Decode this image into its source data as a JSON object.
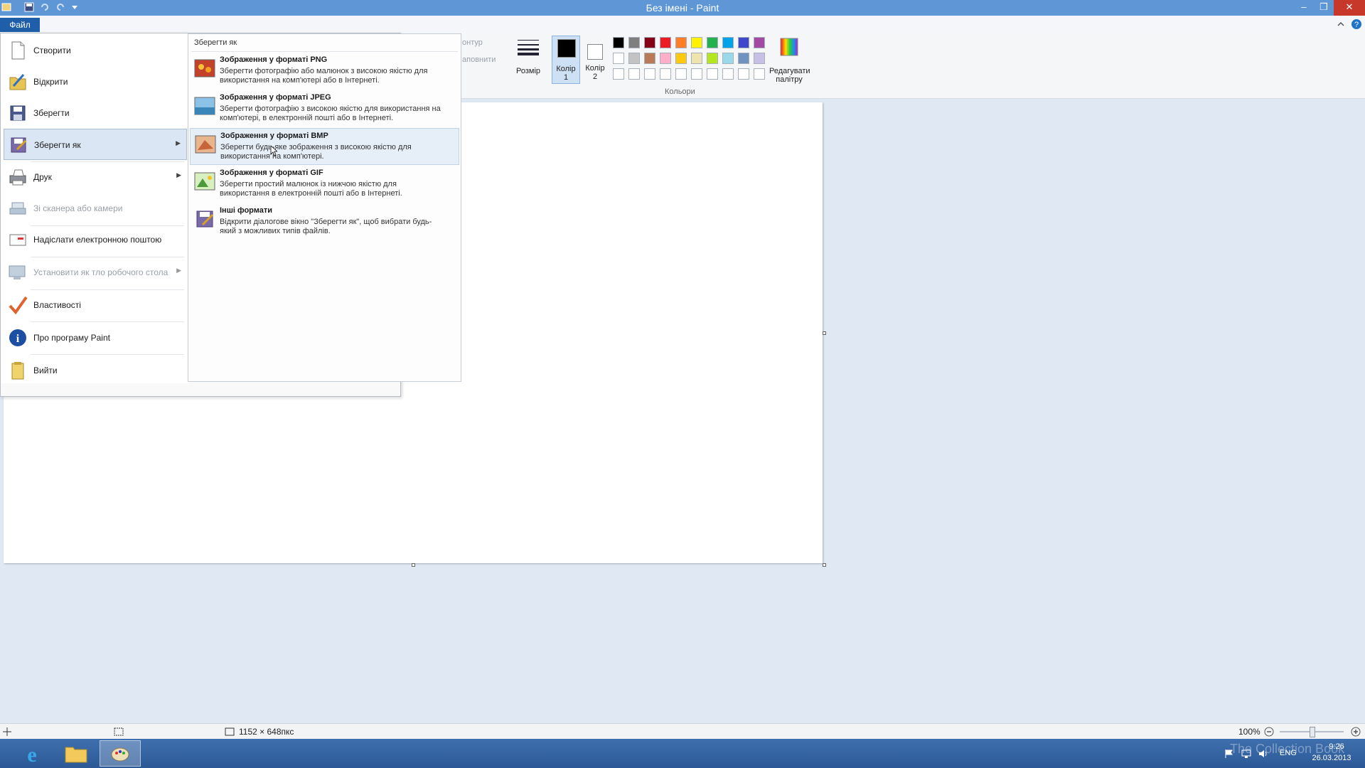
{
  "window": {
    "title": "Без імені - Paint",
    "controls": {
      "minimize": "–",
      "restore": "❐",
      "close": "✕"
    }
  },
  "ribbon": {
    "file_tab": "Файл",
    "shapes": {
      "outline": "онтур",
      "fill": "аповнити"
    },
    "size_label": "Розмір",
    "color1_label": "Колір",
    "color1_num": "1",
    "color2_label": "Колір",
    "color2_num": "2",
    "edit_colors_label": "Редагувати",
    "edit_colors_label2": "палітру",
    "colors_group_label": "Кольори",
    "palette_row1": [
      "#000000",
      "#7f7f7f",
      "#880015",
      "#ed1c24",
      "#ff7f27",
      "#fff200",
      "#22b14c",
      "#00a2e8",
      "#3f48cc",
      "#a349a4"
    ],
    "palette_row2": [
      "#ffffff",
      "#c3c3c3",
      "#b97a57",
      "#ffaec9",
      "#ffc90e",
      "#efe4b0",
      "#b5e61d",
      "#99d9ea",
      "#7092be",
      "#c8bfe7"
    ]
  },
  "file_menu": {
    "items": [
      {
        "label": "Створити",
        "icon": "new-file-icon"
      },
      {
        "label": "Відкрити",
        "icon": "open-folder-icon"
      },
      {
        "label": "Зберегти",
        "icon": "save-disk-icon"
      },
      {
        "label": "Зберегти як",
        "icon": "save-as-icon"
      },
      {
        "label": "Друк",
        "icon": "printer-icon"
      },
      {
        "label": "Зі сканера або камери",
        "icon": "scanner-icon"
      },
      {
        "label": "Надіслати електронною поштою",
        "icon": "email-icon"
      },
      {
        "label": "Установити як тло робочого стола",
        "icon": "desktop-background-icon"
      },
      {
        "label": "Властивості",
        "icon": "checkmark-icon"
      },
      {
        "label": "Про програму Paint",
        "icon": "info-icon"
      },
      {
        "label": "Вийти",
        "icon": "exit-icon"
      }
    ]
  },
  "save_as": {
    "header": "Зберегти як",
    "items": [
      {
        "title": "Зображення у форматі PNG",
        "desc": "Зберегти фотографію або малюнок з високою якістю для використання на комп'ютері або в Інтернеті."
      },
      {
        "title": "Зображення у форматі JPEG",
        "desc": "Зберегти фотографію з високою якістю для використання на комп'ютері, в електронній пошті або в Інтернеті."
      },
      {
        "title": "Зображення у форматі BMP",
        "desc": "Зберегти будь-яке зображення з високою якістю для використання на комп'ютері."
      },
      {
        "title": "Зображення у форматі GIF",
        "desc": "Зберегти простий малюнок із нижчою якістю для використання в електронній пошті або в Інтернеті."
      },
      {
        "title": "Інші формати",
        "desc": "Відкрити діалогове вікно \"Зберегти як\", щоб вибрати будь-який з можливих типів файлів."
      }
    ]
  },
  "status": {
    "dimensions": "1152 × 648пкс",
    "zoom": "100%"
  },
  "taskbar": {
    "lang": "ENG",
    "time": "9:26",
    "date": "26.03.2013",
    "watermark": "The Collection Book"
  }
}
